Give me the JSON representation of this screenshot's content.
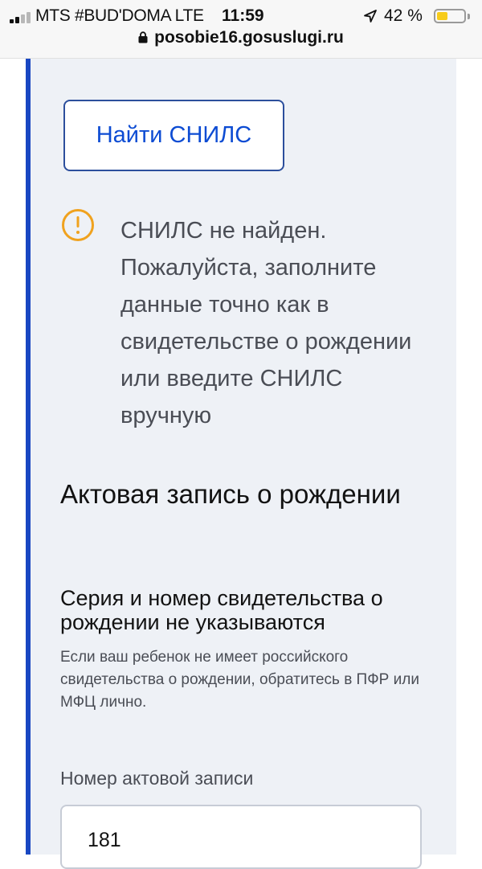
{
  "status_bar": {
    "carrier": "MTS #BUD'DOMA LTE",
    "time": "11:59",
    "battery": "42 %",
    "battery_level": 0.42,
    "url": "posobie16.gosuslugi.ru"
  },
  "form": {
    "find_snils_button": "Найти СНИЛС",
    "warning_message": "СНИЛС не найден. Пожалуйста, заполните данные точно как в свидетельстве о рождении или введите СНИЛС вручную",
    "section_title": "Актовая запись о рождении",
    "certificate_option": "Серия и номер свидетельства о рождении не указываются",
    "certificate_hint": "Если ваш ребенок не имеет российского свидетельства о рождении, обратитесь в ПФР или МФЦ лично.",
    "record_number_label": "Номер актовой записи",
    "record_number_value": "181"
  },
  "colors": {
    "accent": "#1947c2",
    "button_text": "#0d4cd3",
    "warning": "#f0a21e",
    "panel_background": "#eef1f6"
  }
}
